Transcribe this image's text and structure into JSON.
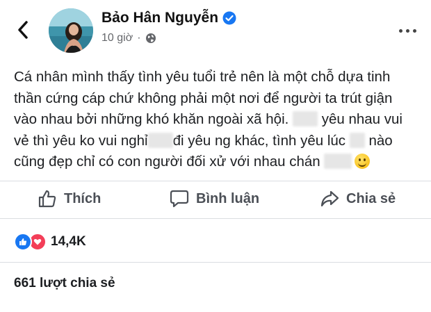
{
  "author": {
    "name": "Bảo Hân Nguyễn",
    "verified": true,
    "time": "10 giờ",
    "separator": "·",
    "audience_icon": "globe-icon"
  },
  "post": {
    "text_lines": [
      "Cá nhân mình thấy tình yêu tuổi trẻ nên là một chỗ dựa tinh",
      "thần cứng cáp chứ không phải một nơi để người ta trút giận",
      "vào nhau bởi những khó khăn ngoài xã hội.",
      "yêu nhau vui",
      "vẻ thì yêu ko vui nghỉ",
      "đi yêu ng khác, tình yêu lúc",
      "nào",
      "cũng đẹp chỉ có con người đối xử với nhau chán"
    ],
    "emoji": "slightly-smiling-face"
  },
  "actions": {
    "like": "Thích",
    "comment": "Bình luận",
    "share": "Chia sẻ"
  },
  "stats": {
    "reaction_count": "14,4K",
    "reaction_types": [
      "like",
      "love"
    ],
    "shares": "661 lượt chia sẻ"
  },
  "colors": {
    "verified_blue": "#1877f2",
    "like_blue": "#1877f2",
    "love_red": "#f33e58",
    "meta_gray": "#65676b",
    "action_gray": "#4b4f56"
  }
}
